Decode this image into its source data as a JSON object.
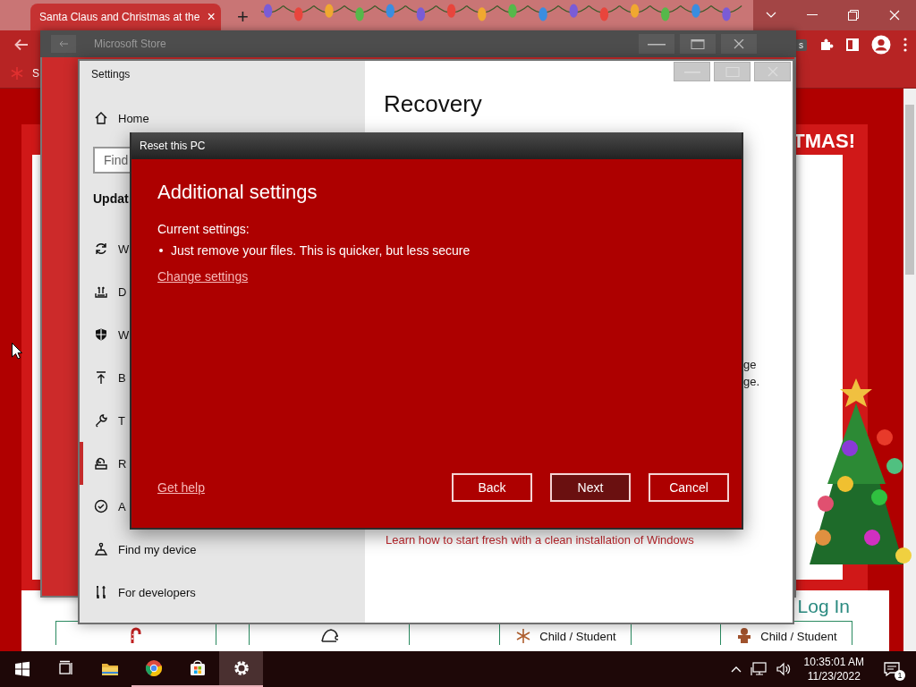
{
  "browser": {
    "tab": {
      "title": "Santa Claus and Christmas at the",
      "close": "×",
      "selected": true
    },
    "new_tab": "+",
    "bookmark": "S",
    "extension_badge": "s",
    "page": {
      "banner": "TMAS!",
      "login": "Log In",
      "cards": [
        {
          "kind": "candy-cane"
        },
        {
          "kind": "santa-hat"
        },
        {
          "kind": "snowflake",
          "label": "Child / Student"
        },
        {
          "kind": "gingerbread",
          "label": "Child / Student"
        }
      ]
    }
  },
  "store_window": {
    "title": "Microsoft Store"
  },
  "settings_window": {
    "title": "Settings",
    "nav": {
      "home": "Home",
      "search_placeholder": "Find",
      "section": "Updat",
      "items": [
        {
          "label": "W",
          "kind": "sync",
          "selected": false
        },
        {
          "label": "D",
          "kind": "delivery",
          "selected": false
        },
        {
          "label": "W",
          "kind": "shield",
          "selected": false
        },
        {
          "label": "B",
          "kind": "backup",
          "selected": false
        },
        {
          "label": "T",
          "kind": "wrench",
          "selected": false
        },
        {
          "label": "R",
          "kind": "recovery",
          "selected": true
        },
        {
          "label": "A",
          "kind": "check",
          "selected": false
        },
        {
          "label": "Find my device",
          "kind": "find",
          "selected": false
        },
        {
          "label": "For developers",
          "kind": "dev",
          "selected": false
        }
      ]
    },
    "content": {
      "heading": "Recovery",
      "fragments": [
        "ge",
        "ge."
      ],
      "link": "Learn how to start fresh with a clean installation of Windows"
    }
  },
  "dialog": {
    "title": "Reset this PC",
    "heading": "Additional settings",
    "current_label": "Current settings:",
    "bullets": [
      "Just remove your files. This is quicker, but less secure"
    ],
    "change_link": "Change settings",
    "help_link": "Get help",
    "buttons": [
      {
        "label": "Back",
        "default": false
      },
      {
        "label": "Next",
        "default": true
      },
      {
        "label": "Cancel",
        "default": false
      }
    ]
  },
  "taskbar": {
    "apps": [
      {
        "kind": "start",
        "running": false,
        "active": false
      },
      {
        "kind": "task-view",
        "running": false,
        "active": false
      },
      {
        "kind": "folder",
        "running": false,
        "active": false
      },
      {
        "kind": "chrome",
        "running": true,
        "active": false
      },
      {
        "kind": "store",
        "running": true,
        "active": false
      },
      {
        "kind": "settings",
        "running": true,
        "active": true
      }
    ],
    "time": "10:35:01 AM",
    "date": "11/23/2022",
    "notifications": "1"
  }
}
